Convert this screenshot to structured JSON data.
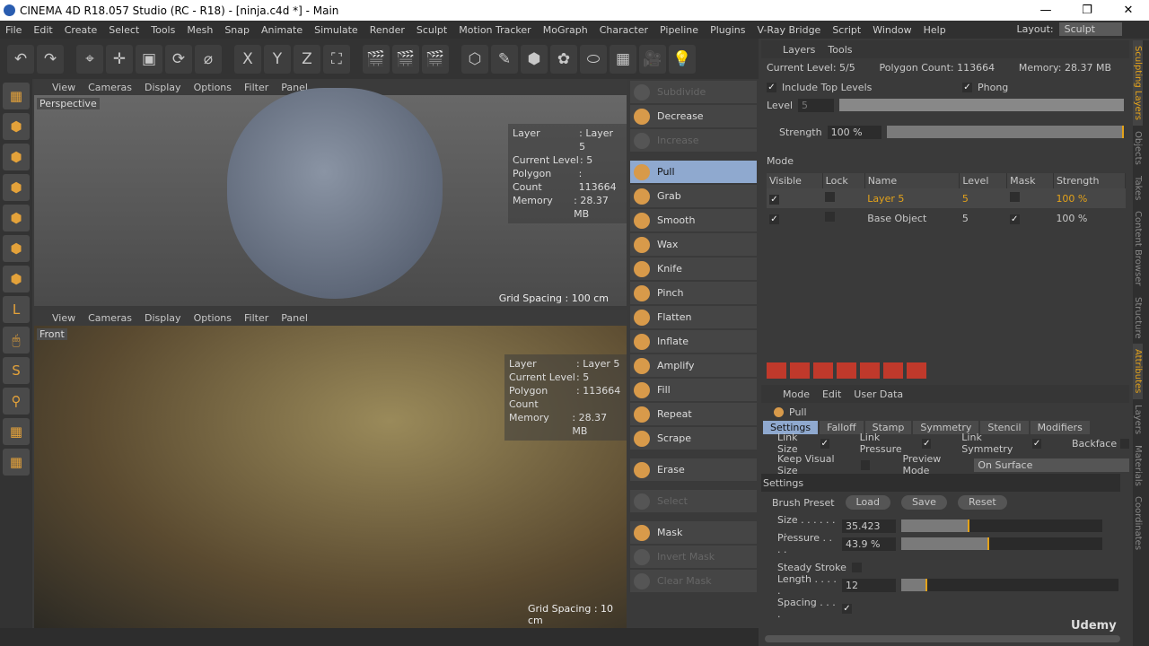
{
  "title": "CINEMA 4D R18.057 Studio (RC - R18) - [ninja.c4d *] - Main",
  "window_buttons": [
    "—",
    "❐",
    "✕"
  ],
  "menu": [
    "File",
    "Edit",
    "Create",
    "Select",
    "Tools",
    "Mesh",
    "Snap",
    "Animate",
    "Simulate",
    "Render",
    "Sculpt",
    "Motion Tracker",
    "MoGraph",
    "Character",
    "Pipeline",
    "Plugins",
    "V-Ray Bridge",
    "Script",
    "Window",
    "Help"
  ],
  "layout": {
    "label": "Layout:",
    "value": "Sculpt"
  },
  "toolbar_icons": [
    "↶",
    "↷",
    "⌖",
    "✛",
    "▣",
    "⟳",
    "⌀",
    "X",
    "Y",
    "Z",
    "⛶",
    "🎬",
    "🎬",
    "🎬",
    "⬡",
    "✎",
    "⬢",
    "✿",
    "⬭",
    "▦",
    "🎥",
    "💡"
  ],
  "left_tools": [
    "▦",
    "⬢",
    "⬢",
    "⬢",
    "⬢",
    "⬢",
    "⬢",
    "L",
    "🖱",
    "S",
    "⚲",
    "▦",
    "▦"
  ],
  "viewport_top": {
    "menu": [
      "View",
      "Cameras",
      "Display",
      "Options",
      "Filter",
      "Panel"
    ],
    "name": "Perspective",
    "hud": [
      [
        "Layer",
        ": Layer 5"
      ],
      [
        "Current Level",
        ": 5"
      ],
      [
        "Polygon Count",
        ": 113664"
      ],
      [
        "Memory",
        ": 28.37 MB"
      ]
    ],
    "grid": "Grid Spacing : 100 cm"
  },
  "viewport_bottom": {
    "menu": [
      "View",
      "Cameras",
      "Display",
      "Options",
      "Filter",
      "Panel"
    ],
    "name": "Front",
    "hud": [
      [
        "Layer",
        ": Layer 5"
      ],
      [
        "Current Level",
        ": 5"
      ],
      [
        "Polygon Count",
        ": 113664"
      ],
      [
        "Memory",
        ": 28.37 MB"
      ]
    ],
    "grid": "Grid Spacing : 10 cm"
  },
  "brushes": [
    {
      "label": "Subdivide",
      "state": "disabled"
    },
    {
      "label": "Decrease",
      "state": "normal"
    },
    {
      "label": "Increase",
      "state": "disabled"
    },
    {
      "label": "Pull",
      "state": "active",
      "gap": true
    },
    {
      "label": "Grab"
    },
    {
      "label": "Smooth"
    },
    {
      "label": "Wax"
    },
    {
      "label": "Knife"
    },
    {
      "label": "Pinch"
    },
    {
      "label": "Flatten"
    },
    {
      "label": "Inflate"
    },
    {
      "label": "Amplify"
    },
    {
      "label": "Fill"
    },
    {
      "label": "Repeat"
    },
    {
      "label": "Scrape"
    },
    {
      "label": "Erase",
      "gap": true
    },
    {
      "label": "Select",
      "state": "disabled",
      "gap": true
    },
    {
      "label": "Mask",
      "gap": true
    },
    {
      "label": "Invert Mask",
      "state": "disabled"
    },
    {
      "label": "Clear Mask",
      "state": "disabled"
    }
  ],
  "layers_panel": {
    "menu": [
      "Layers",
      "Tools"
    ],
    "current_level": "Current Level: 5/5",
    "polygon_count": "Polygon Count: 113664",
    "memory": "Memory: 28.37 MB",
    "include_top_levels": "Include Top Levels",
    "phong": "Phong",
    "level_label": "Level",
    "level_value": "5",
    "strength_label": "Strength",
    "strength_value": "100 %",
    "strength_fraction": 1.0,
    "mode_label": "Mode",
    "columns": [
      "Visible",
      "Lock",
      "Name",
      "Level",
      "Mask",
      "Strength"
    ],
    "rows": [
      {
        "name": "Layer 5",
        "level": "5",
        "strength": "100 %",
        "visible": "✓",
        "mask": ""
      },
      {
        "name": "Base Object",
        "level": "5",
        "strength": "100 %",
        "visible": "✓",
        "mask": "✓"
      }
    ],
    "highlight_color": "#e3a21a"
  },
  "attributes": {
    "menu": [
      "Mode",
      "Edit",
      "User Data"
    ],
    "object": "Pull",
    "tabs": [
      "Settings",
      "Falloff",
      "Stamp",
      "Symmetry",
      "Stencil",
      "Modifiers"
    ],
    "link_size": "Link Size",
    "link_pressure": "Link Pressure",
    "link_symmetry": "Link Symmetry",
    "backface": "Backface",
    "keep_visual_size": "Keep Visual Size",
    "preview_mode_label": "Preview Mode",
    "preview_mode": "On Surface",
    "section": "Settings",
    "brush_preset": "Brush Preset",
    "load": "Load",
    "save": "Save",
    "reset": "Reset",
    "size_label": "Size . . . . . . . .",
    "size": "35.423",
    "size_fraction": 0.34,
    "pressure_label": "Pressure . . . .",
    "pressure": "43.9 %",
    "pressure_fraction": 0.439,
    "steady_stroke": "Steady Stroke",
    "length_label": "Length . . . . .",
    "length": "12",
    "length_fraction": 0.12,
    "spacing_label": "Spacing . . . ."
  },
  "side_tabs": [
    "Sculpting Layers",
    "Objects",
    "Takes",
    "Content Browser",
    "Structure",
    "Attributes",
    "Layers",
    "Materials",
    "Coordinates"
  ],
  "watermark": "Udemy"
}
